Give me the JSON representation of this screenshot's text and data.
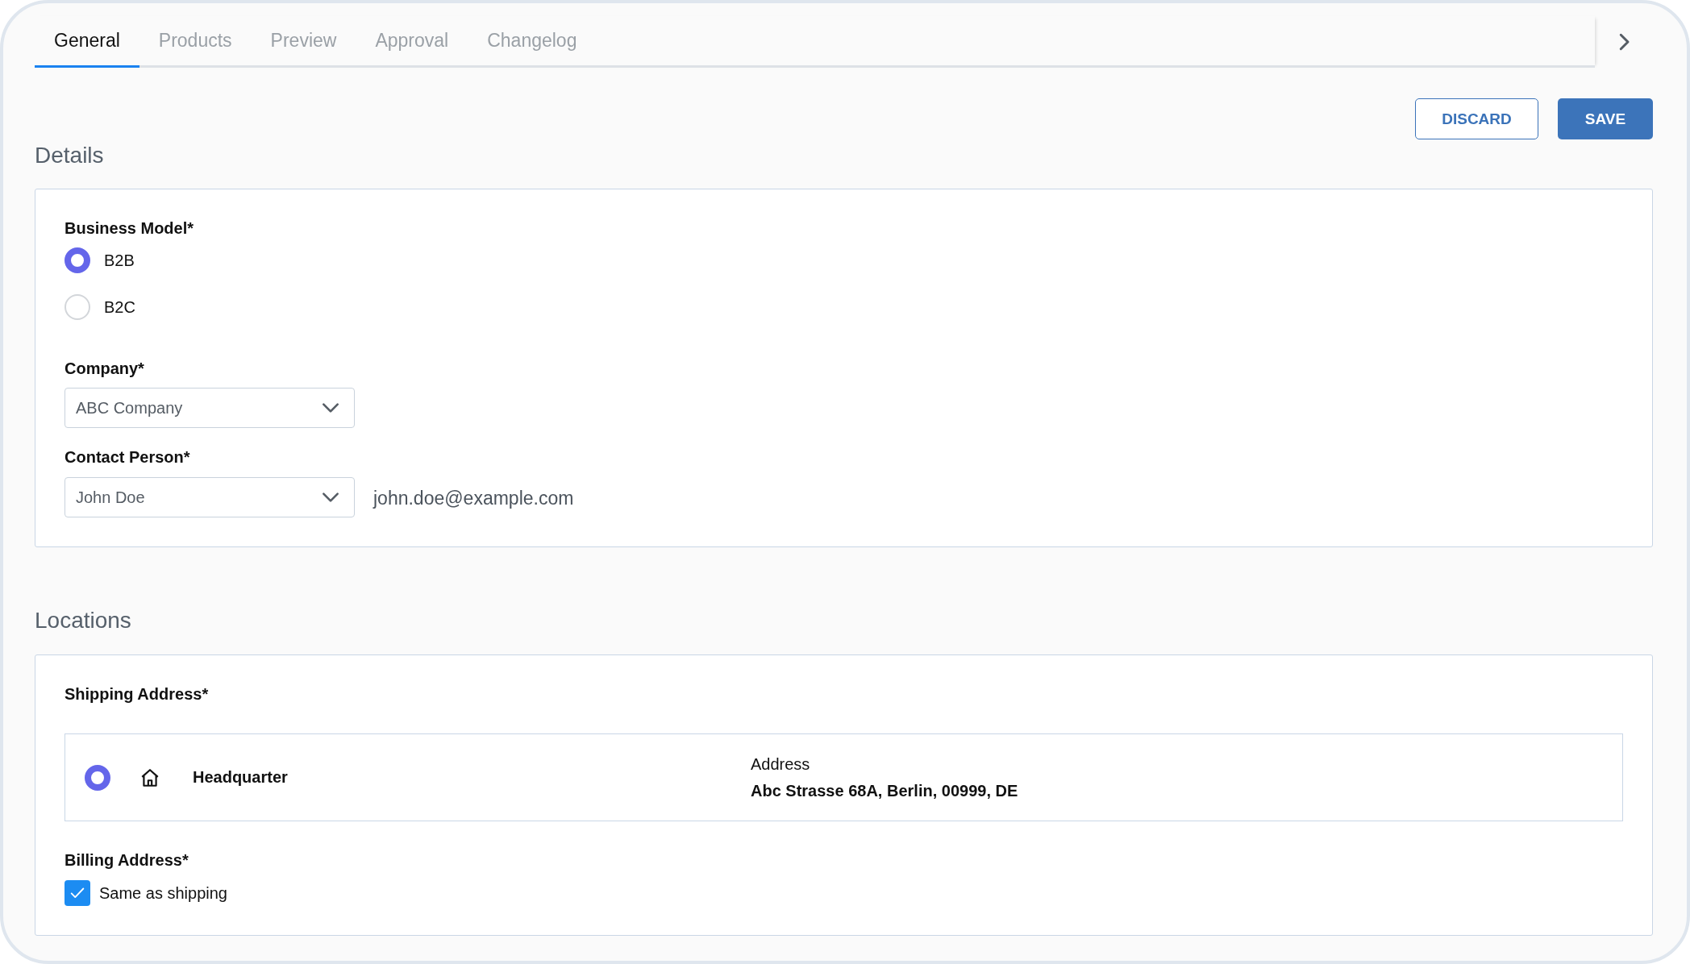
{
  "tabs": [
    {
      "label": "General",
      "selected": true
    },
    {
      "label": "Products",
      "selected": false
    },
    {
      "label": "Preview",
      "selected": false
    },
    {
      "label": "Approval",
      "selected": false
    },
    {
      "label": "Changelog",
      "selected": false
    }
  ],
  "actions": {
    "discard": "DISCARD",
    "save": "SAVE"
  },
  "details": {
    "title": "Details",
    "business_model": {
      "label": "Business Model*",
      "options": [
        {
          "label": "B2B",
          "selected": true
        },
        {
          "label": "B2C",
          "selected": false
        }
      ]
    },
    "company": {
      "label": "Company*",
      "value": "ABC Company"
    },
    "contact_person": {
      "label": "Contact Person*",
      "value": "John Doe",
      "email": "john.doe@example.com"
    }
  },
  "locations": {
    "title": "Locations",
    "shipping": {
      "label": "Shipping Address*",
      "addresses": [
        {
          "name": "Headquarter",
          "selected": true,
          "address_label": "Address",
          "address": "Abc Strasse 68A, Berlin, 00999, DE"
        }
      ]
    },
    "billing": {
      "label": "Billing Address*",
      "same_as_shipping": {
        "label": "Same as shipping",
        "checked": true
      }
    }
  }
}
